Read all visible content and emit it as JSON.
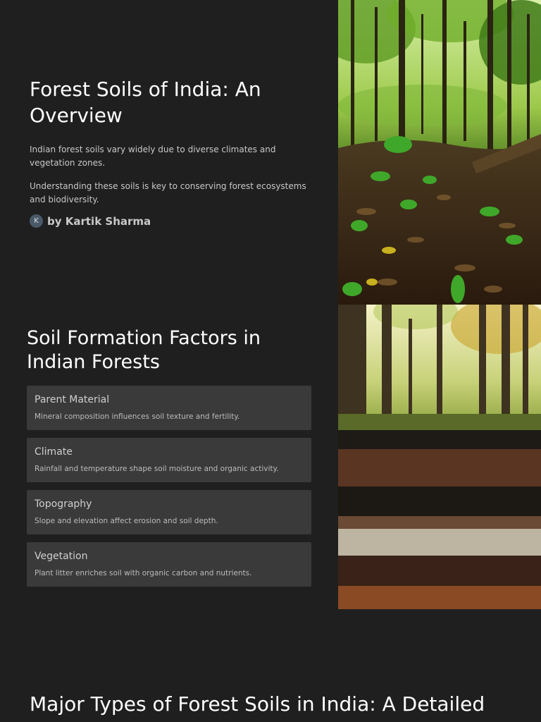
{
  "hero": {
    "title": "Forest Soils of India: An Overview",
    "paragraph1": "Indian forest soils vary widely due to diverse climates and vegetation zones.",
    "paragraph2": "Understanding these soils is key to conserving forest ecosystems and biodiversity.",
    "author_initial": "K",
    "author": "by Kartik Sharma"
  },
  "factors": {
    "title": "Soil Formation Factors in Indian Forests",
    "items": [
      {
        "title": "Parent Material",
        "text": "Mineral composition influences soil texture and fertility."
      },
      {
        "title": "Climate",
        "text": "Rainfall and temperature shape soil moisture and organic activity."
      },
      {
        "title": "Topography",
        "text": "Slope and elevation affect erosion and soil depth."
      },
      {
        "title": "Vegetation",
        "text": "Plant litter enriches soil with organic carbon and nutrients."
      }
    ]
  },
  "major": {
    "title": "Major Types of Forest Soils in India: A Detailed"
  }
}
